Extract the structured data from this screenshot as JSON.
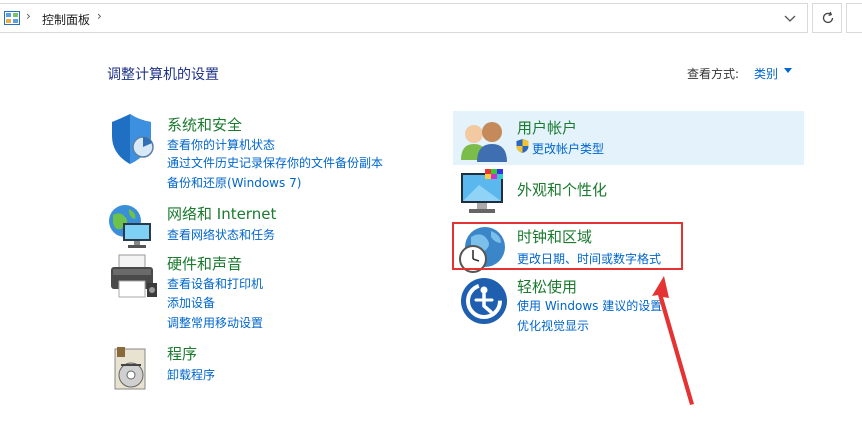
{
  "address": {
    "breadcrumb": "控制面板"
  },
  "header": {
    "title": "调整计算机的设置",
    "view_label": "查看方式:",
    "view_value": "类别"
  },
  "left_categories": [
    {
      "title": "系统和安全",
      "links": [
        "查看你的计算机状态",
        "通过文件历史记录保存你的文件备份副本",
        "备份和还原(Windows 7)"
      ]
    },
    {
      "title": "网络和 Internet",
      "links": [
        "查看网络状态和任务"
      ]
    },
    {
      "title": "硬件和声音",
      "links": [
        "查看设备和打印机",
        "添加设备",
        "调整常用移动设置"
      ]
    },
    {
      "title": "程序",
      "links": [
        "卸载程序"
      ]
    }
  ],
  "right_categories": [
    {
      "title": "用户帐户",
      "links": [
        "更改帐户类型"
      ]
    },
    {
      "title": "外观和个性化",
      "links": []
    },
    {
      "title": "时钟和区域",
      "links": [
        "更改日期、时间或数字格式"
      ]
    },
    {
      "title": "轻松使用",
      "links": [
        "使用 Windows 建议的设置",
        "优化视觉显示"
      ]
    }
  ],
  "colors": {
    "title_green": "#1a7a2e",
    "link_blue": "#0066cc",
    "highlight": "#e3f2fb",
    "annotation_red": "#e53333"
  }
}
